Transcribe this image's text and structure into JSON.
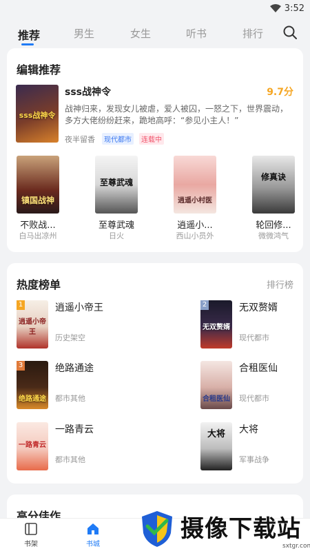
{
  "status_bar": {
    "time": "3:52"
  },
  "tabs": [
    {
      "label": "推荐",
      "active": true
    },
    {
      "label": "男生"
    },
    {
      "label": "女生"
    },
    {
      "label": "听书"
    },
    {
      "label": "排行"
    }
  ],
  "editor_picks": {
    "title": "编辑推荐",
    "featured": {
      "cover_text": "sss战神令",
      "title": "sss战神令",
      "score": "9.7分",
      "description": "战神归来，发现女儿被虐，爱人被囚，一怒之下，世界震动，多方大佬纷纷赶来，跪地高呼：“参见小主人！”",
      "author": "夜半留香",
      "tags": [
        "现代都市",
        "连载中"
      ]
    },
    "grid": [
      {
        "title": "不败战...",
        "author": "白马出凉州",
        "cover_text": "镇国战神"
      },
      {
        "title": "至尊武魂",
        "author": "日火",
        "cover_text": "至尊武魂"
      },
      {
        "title": "逍遥小...",
        "author": "西山小员外",
        "cover_text": "逍遥小村医"
      },
      {
        "title": "轮回修...",
        "author": "微微鸿气",
        "cover_text": "修真诀"
      }
    ]
  },
  "hot_list": {
    "title": "热度榜单",
    "more": "排行榜",
    "items": [
      {
        "rank": "1",
        "title": "逍遥小帝王",
        "category": "历史架空",
        "cover_text": "逍遥小帝王"
      },
      {
        "rank": "2",
        "title": "无双赘婿",
        "category": "现代都市",
        "cover_text": "无双赘婿"
      },
      {
        "rank": "3",
        "title": "绝路通途",
        "category": "都市其他",
        "cover_text": "绝路通途"
      },
      {
        "rank": "",
        "title": "合租医仙",
        "category": "现代都市",
        "cover_text": "合租医仙"
      },
      {
        "rank": "",
        "title": "一路青云",
        "category": "都市其他",
        "cover_text": "一路青云"
      },
      {
        "rank": "",
        "title": "大将",
        "category": "军事战争",
        "cover_text": "大将"
      }
    ]
  },
  "high_score": {
    "title": "高分佳作"
  },
  "bottom_nav": [
    {
      "label": "书架",
      "icon": "bookshelf-icon"
    },
    {
      "label": "书城",
      "icon": "home-icon",
      "active": true
    }
  ],
  "watermark": {
    "text": "摄像下载站",
    "url": "sxtgr.com"
  },
  "colors": {
    "accent": "#1f7bf6",
    "score": "#f5a623",
    "tag_blue": "#3b78f0",
    "tag_red": "#f0556c"
  }
}
